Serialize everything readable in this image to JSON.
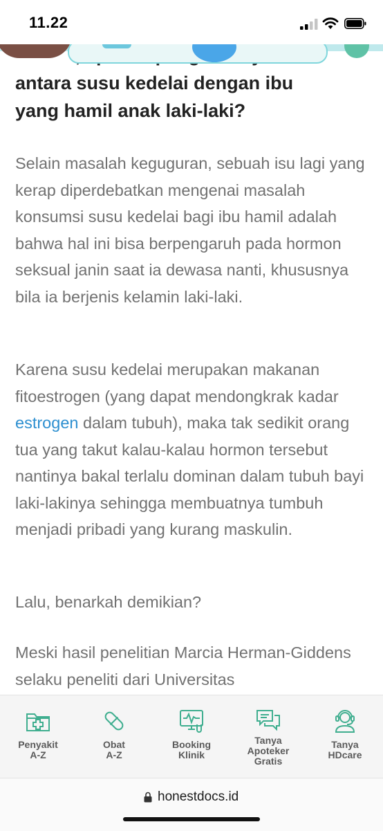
{
  "status_bar": {
    "time": "11.22"
  },
  "article": {
    "heading_partial_line": "Bahwa, apakah pengaruhnya",
    "heading_line_2": "antara susu kedelai dengan ibu",
    "heading_line_3": "yang hamil anak laki-laki?",
    "paragraph_1": "Selain masalah keguguran, sebuah isu lagi yang kerap diperdebatkan mengenai masalah konsumsi susu kedelai bagi ibu hamil adalah bahwa hal ini bisa berpengaruh pada hormon seksual janin saat ia dewasa nanti, khususnya bila ia berjenis kelamin laki-laki.",
    "paragraph_2_before_link": "Karena susu kedelai merupakan makanan fitoestrogen (yang dapat mendongkrak kadar ",
    "paragraph_2_link": "estrogen",
    "paragraph_2_after_link": " dalam tubuh), maka tak sedikit orang tua yang takut kalau-kalau hormon tersebut nantinya bakal terlalu dominan dalam tubuh bayi laki-lakinya sehingga membuatnya tumbuh menjadi pribadi yang kurang maskulin.",
    "paragraph_3": "Lalu, benarkah demikian?",
    "paragraph_4": "Meski hasil penelitian Marcia Herman-Giddens selaku peneliti dari Universitas"
  },
  "bottom_nav": {
    "items": [
      {
        "label": "Penyakit\nA-Z",
        "icon": "folder-medical-icon"
      },
      {
        "label": "Obat\nA-Z",
        "icon": "pill-capsule-icon"
      },
      {
        "label": "Booking\nKlinik",
        "icon": "lab-monitor-icon"
      },
      {
        "label": "Tanya\nApoteker\nGratis",
        "icon": "chat-bubbles-icon"
      },
      {
        "label": "Tanya\nHDcare",
        "icon": "headset-agent-icon"
      }
    ],
    "icon_color": "#3fae8f"
  },
  "browser": {
    "url": "honestdocs.id"
  },
  "colors": {
    "heading": "#222222",
    "body_text": "#717171",
    "link": "#2d8fd0",
    "nav_background": "#f5f5f5"
  }
}
